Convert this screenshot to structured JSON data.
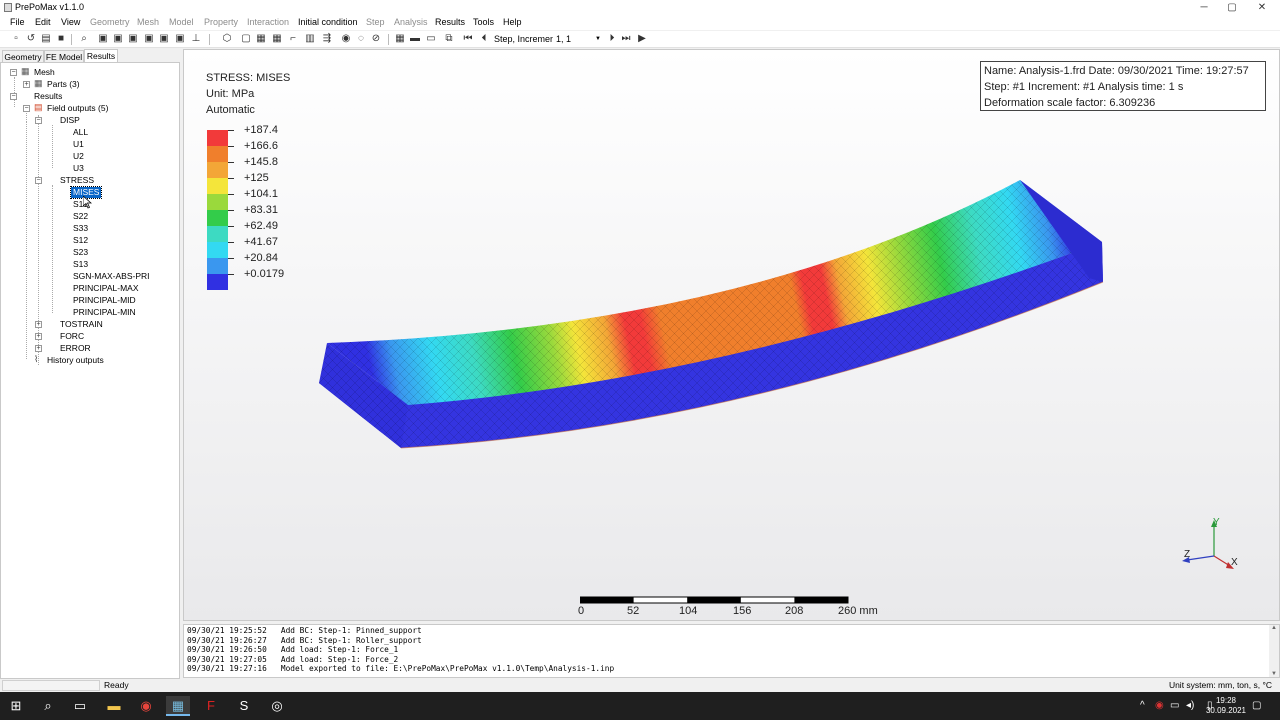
{
  "window": {
    "title": "PrePoMax v1.1.0",
    "controls": {
      "minimize": "─",
      "maximize": "▢",
      "close": "✕"
    }
  },
  "menu": {
    "items": [
      {
        "label": "File"
      },
      {
        "label": "Edit"
      },
      {
        "label": "View"
      },
      {
        "label": "Geometry"
      },
      {
        "label": "Mesh"
      },
      {
        "label": "Model"
      },
      {
        "label": "Property"
      },
      {
        "label": "Interaction"
      },
      {
        "label": "Initial condition"
      },
      {
        "label": "Step"
      },
      {
        "label": "Analysis"
      },
      {
        "label": "Results"
      },
      {
        "label": "Tools"
      },
      {
        "label": "Help"
      }
    ]
  },
  "toolbar": {
    "step_label": "Step, Increment",
    "step_value": "1, 1"
  },
  "tabs": [
    {
      "label": "Geometry"
    },
    {
      "label": "FE Model"
    },
    {
      "label": "Results"
    }
  ],
  "tree": {
    "mesh": "Mesh",
    "parts": "Parts (3)",
    "results": "Results",
    "field_outputs": "Field outputs (5)",
    "disp": "DISP",
    "disp_items": [
      "ALL",
      "U1",
      "U2",
      "U3"
    ],
    "stress": "STRESS",
    "stress_items": [
      "MISES",
      "S11",
      "S22",
      "S33",
      "S12",
      "S23",
      "S13",
      "SGN-MAX-ABS-PRI",
      "PRINCIPAL-MAX",
      "PRINCIPAL-MID",
      "PRINCIPAL-MIN"
    ],
    "tostrain": "TOSTRAIN",
    "forc": "FORC",
    "error": "ERROR",
    "history_outputs": "History outputs"
  },
  "legend": {
    "title": "STRESS: MISES",
    "unit": "Unit: MPa",
    "mode": "Automatic",
    "values": [
      "+187.4",
      "+166.6",
      "+145.8",
      "+125",
      "+104.1",
      "+83.31",
      "+62.49",
      "+41.67",
      "+20.84",
      "+0.0179"
    ],
    "colors": [
      "#f23a3a",
      "#f07f2c",
      "#f3a637",
      "#f4e53a",
      "#9ad93c",
      "#33cc4a",
      "#3ddac2",
      "#33d9f2",
      "#3a97ef",
      "#3030e2"
    ]
  },
  "info": {
    "line1": "Name: Analysis-1.frd   Date: 09/30/2021   Time: 19:27:57",
    "line2": "Step: #1   Increment: #1   Analysis time: 1 s",
    "line3": "Deformation scale factor: 6.309236"
  },
  "scalebar": {
    "labels": [
      "0",
      "52",
      "104",
      "156",
      "208",
      "260 mm"
    ]
  },
  "axes": {
    "x": "X",
    "y": "Y",
    "z": "Z"
  },
  "log": [
    "09/30/21 19:25:52   Add BC: Step-1: Pinned_support",
    "09/30/21 19:26:27   Add BC: Step-1: Roller_support",
    "09/30/21 19:26:50   Add load: Step-1: Force_1",
    "09/30/21 19:27:05   Add load: Step-1: Force_2",
    "09/30/21 19:27:16   Model exported to file: E:\\PrePoMax\\PrePoMax v1.1.0\\Temp\\Analysis-1.inp"
  ],
  "status": {
    "left": "Ready",
    "right": "Unit system: mm, ton, s, °C"
  },
  "taskbar": {
    "time": "19:28",
    "date": "30.09.2021"
  }
}
